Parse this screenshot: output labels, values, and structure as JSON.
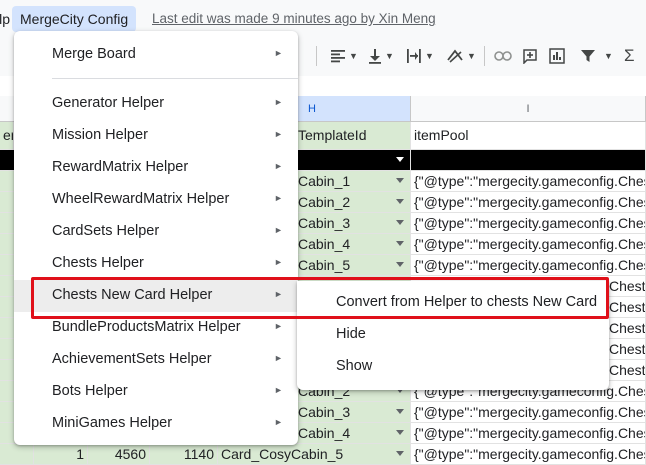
{
  "menubar": {
    "partial_item": "Help",
    "active_item": "MergeCity Config",
    "last_edit": "Last edit was made 9 minutes ago by Xin Meng"
  },
  "toolbar": {
    "icons": [
      "align-left-icon",
      "vertical-align-bottom-icon",
      "text-wrap-icon",
      "text-rotation-icon",
      "link-icon",
      "insert-comment-icon",
      "insert-chart-icon",
      "filter-icon",
      "functions-icon"
    ]
  },
  "sheet": {
    "columns": [
      {
        "label": "",
        "name": "col-g"
      },
      {
        "label": "H",
        "name": "col-h"
      },
      {
        "label": "I",
        "name": "col-i"
      }
    ],
    "header_row": {
      "partial": "en",
      "h": "TemplateId",
      "i": "itemPool"
    },
    "rows": [
      {
        "h": "Cabin_1",
        "i": "{\"@type\":\"mergecity.gameconfig.ChestI"
      },
      {
        "h": "Cabin_2",
        "i": "{\"@type\":\"mergecity.gameconfig.ChestI"
      },
      {
        "h": "Cabin_3",
        "i": "{\"@type\":\"mergecity.gameconfig.ChestI"
      },
      {
        "h": "Cabin_4",
        "i": "{\"@type\":\"mergecity.gameconfig.ChestI"
      },
      {
        "h": "Cabin_5",
        "i": "{\"@type\":\"mergecity.gameconfig.ChestI"
      },
      {
        "h": "",
        "i": "Chest"
      },
      {
        "h": "",
        "i": "Chest"
      },
      {
        "h": "",
        "i": "Chest"
      },
      {
        "h": "",
        "i": "Chest"
      },
      {
        "h": "",
        "i": "Chest"
      },
      {
        "h": "Cabin_2",
        "i": "{\"@type\":\"mergecity.gameconfig.Chest"
      },
      {
        "h": "Cabin_3",
        "i": "{\"@type\":\"mergecity.gameconfig.Chest"
      },
      {
        "h": "Cabin_4",
        "i": "{\"@type\":\"mergecity.gameconfig.Chest"
      }
    ],
    "last_row": {
      "a": "1",
      "b": "4560",
      "c": "1140",
      "h": "Card_CosyCabin_5",
      "i": "{\"@type\":\"mergecity.gameconfig.ChestI"
    }
  },
  "menu": {
    "items": [
      {
        "label": "Merge Board",
        "has_submenu": true
      },
      {
        "label": "Generator Helper",
        "has_submenu": true
      },
      {
        "label": "Mission Helper",
        "has_submenu": true
      },
      {
        "label": "RewardMatrix Helper",
        "has_submenu": true
      },
      {
        "label": "WheelRewardMatrix Helper",
        "has_submenu": true
      },
      {
        "label": "CardSets Helper",
        "has_submenu": true
      },
      {
        "label": "Chests Helper",
        "has_submenu": true
      },
      {
        "label": "Chests New Card Helper",
        "has_submenu": true
      },
      {
        "label": "BundleProductsMatrix Helper",
        "has_submenu": true
      },
      {
        "label": "AchievementSets Helper",
        "has_submenu": true
      },
      {
        "label": "Bots Helper",
        "has_submenu": true
      },
      {
        "label": "MiniGames Helper",
        "has_submenu": true
      }
    ],
    "arrow": "►"
  },
  "submenu": {
    "items": [
      {
        "label": "Convert from Helper to chests New Card"
      },
      {
        "label": "Hide"
      },
      {
        "label": "Show"
      }
    ]
  },
  "colors": {
    "highlight": "#e0101a",
    "green_cell": "#d9ead3",
    "active_menu": "#d3e3fd"
  }
}
